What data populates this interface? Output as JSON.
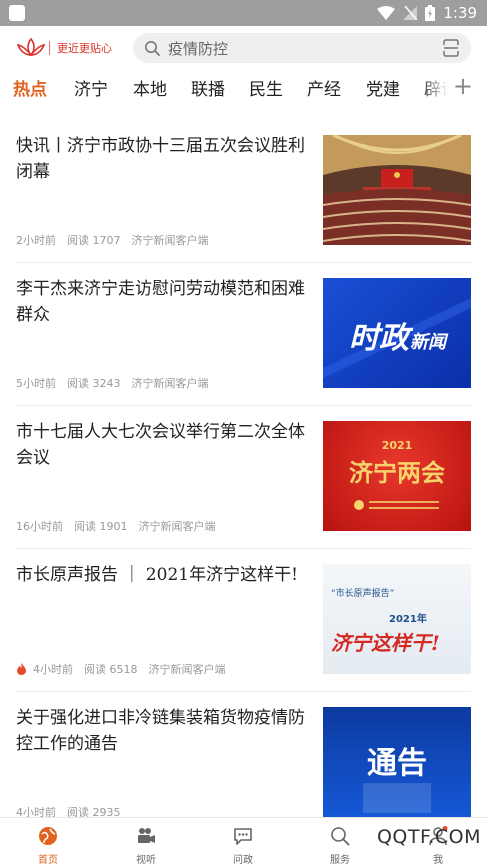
{
  "status_bar": {
    "time": "1:39"
  },
  "header": {
    "logo_text": "更近更贴心",
    "search_placeholder": "疫情防控"
  },
  "tabs": [
    {
      "label": "热点",
      "active": true
    },
    {
      "label": "济宁"
    },
    {
      "label": "本地"
    },
    {
      "label": "联播"
    },
    {
      "label": "民生"
    },
    {
      "label": "产经"
    },
    {
      "label": "党建"
    },
    {
      "label": "辟谣"
    }
  ],
  "news": [
    {
      "title": "快讯丨济宁市政协十三届五次会议胜利闭幕",
      "time": "2小时前",
      "reads": "阅读 1707",
      "source": "济宁新闻客户端",
      "thumb": "conference-hall-photo"
    },
    {
      "title": "李干杰来济宁走访慰问劳动模范和困难群众",
      "time": "5小时前",
      "reads": "阅读 3243",
      "source": "济宁新闻客户端",
      "thumb": "shizheng-news-banner",
      "thumb_text_big": "时政",
      "thumb_text_small": "新闻"
    },
    {
      "title": "市十七届人大七次会议举行第二次全体会议",
      "time": "16小时前",
      "reads": "阅读 1901",
      "source": "济宁新闻客户端",
      "thumb": "jining-lianghui-banner",
      "thumb_year": "2021",
      "thumb_title": "济宁两会"
    },
    {
      "title": "市长原声报告 ｜ 2021年济宁这样干!",
      "time": "4小时前",
      "reads": "阅读 6518",
      "source": "济宁新闻客户端",
      "hot": true,
      "thumb": "mayor-report-banner",
      "thumb_quote": "“市长原声报告”",
      "thumb_year": "2021年",
      "thumb_title": "济宁这样干!"
    },
    {
      "title": "关于强化进口非冷链集装箱货物疫情防控工作的通告",
      "time": "4小时前",
      "reads": "阅读 2935",
      "source": "",
      "thumb": "notice-banner",
      "thumb_text": "通告"
    }
  ],
  "bottom_nav": [
    {
      "label": "首页",
      "icon": "home-globe-icon",
      "active": true
    },
    {
      "label": "视听",
      "icon": "video-camera-icon"
    },
    {
      "label": "问政",
      "icon": "chat-bubble-icon"
    },
    {
      "label": "服务",
      "icon": "search-service-icon"
    },
    {
      "label": "我",
      "icon": "user-icon"
    }
  ],
  "watermark": "QQTF.COM",
  "colors": {
    "accent": "#e0631f",
    "brand_red": "#d8332a"
  }
}
